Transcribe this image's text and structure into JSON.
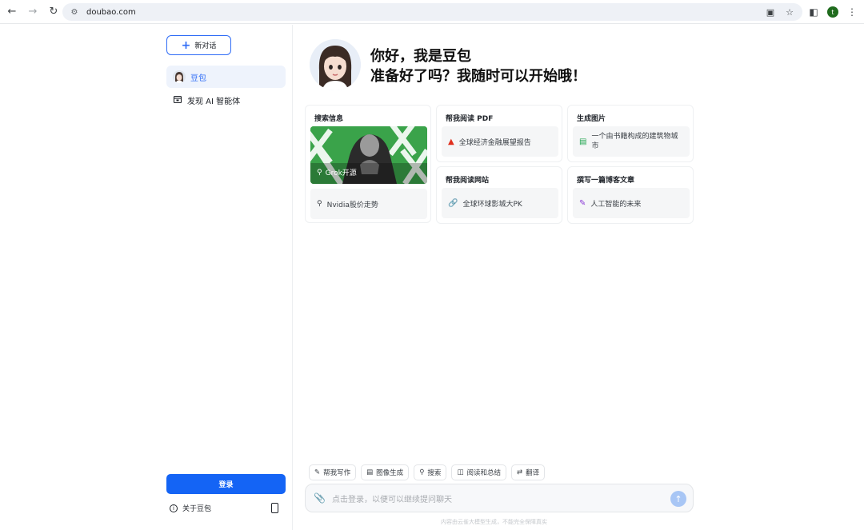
{
  "browser": {
    "url": "doubao.com",
    "profile_initial": "t"
  },
  "sidebar": {
    "new_chat_label": "新对话",
    "items": [
      {
        "label": "豆包",
        "active": true
      },
      {
        "label": "发现 AI 智能体",
        "active": false
      }
    ],
    "login_label": "登录",
    "about_label": "关于豆包"
  },
  "hero": {
    "line1": "你好，我是豆包",
    "line2": "准备好了吗？我随时可以开始哦！"
  },
  "cards": {
    "search": {
      "title": "搜索信息",
      "image_caption": "Grok开源",
      "item": "Nvidia股价走势"
    },
    "read_pdf": {
      "title": "帮我阅读 PDF",
      "item": "全球经济金融展望报告"
    },
    "gen_image": {
      "title": "生成图片",
      "item": "一个由书籍构成的建筑物城市"
    },
    "read_web": {
      "title": "帮我阅读网站",
      "item": "全球环球影城大PK"
    },
    "write_blog": {
      "title": "撰写一篇博客文章",
      "item": "人工智能的未来"
    }
  },
  "tools": [
    "帮我写作",
    "图像生成",
    "搜索",
    "阅读和总结",
    "翻译"
  ],
  "input": {
    "placeholder": "点击登录，以便可以继续提问聊天"
  },
  "disclaimer": "内容由云雀大模型生成，不能完全保障真实",
  "colors": {
    "accent": "#1464f5",
    "active_bg": "#eef3fc"
  }
}
